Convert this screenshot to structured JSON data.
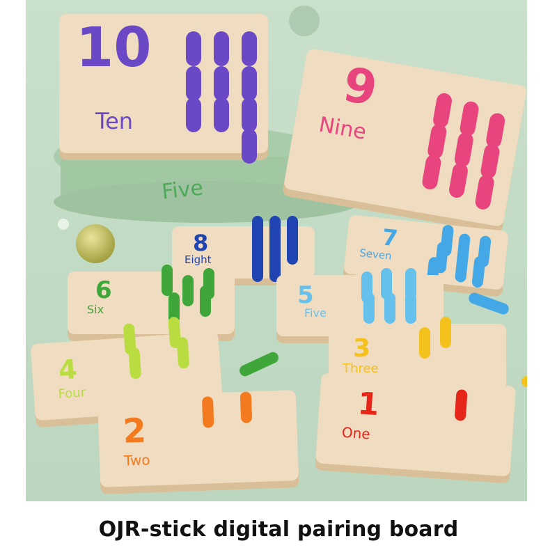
{
  "caption": "OJR-stick digital pairing board",
  "colors": {
    "background": "#c5dcc7",
    "wood": "#f0dcc0",
    "ten": "#6a48c6",
    "nine": "#e8447e",
    "eight": "#2144b3",
    "seven": "#45a8e6",
    "six": "#66c0ec",
    "five": "#3fa63a",
    "four": "#b9dd40",
    "three": "#f4c11d",
    "two": "#f47a1f",
    "one": "#e7261a"
  },
  "boards": [
    {
      "number": "10",
      "word": "Ten"
    },
    {
      "number": "9",
      "word": "Nine"
    },
    {
      "number": "8",
      "word": "Eight"
    },
    {
      "number": "7",
      "word": "Seven"
    },
    {
      "number": "6",
      "word": "Six"
    },
    {
      "number": "5",
      "word": "Five"
    },
    {
      "number": "4",
      "word": "Four"
    },
    {
      "number": "3",
      "word": "Three"
    },
    {
      "number": "2",
      "word": "Two"
    },
    {
      "number": "1",
      "word": "One"
    }
  ],
  "pedestal_text": "Five"
}
